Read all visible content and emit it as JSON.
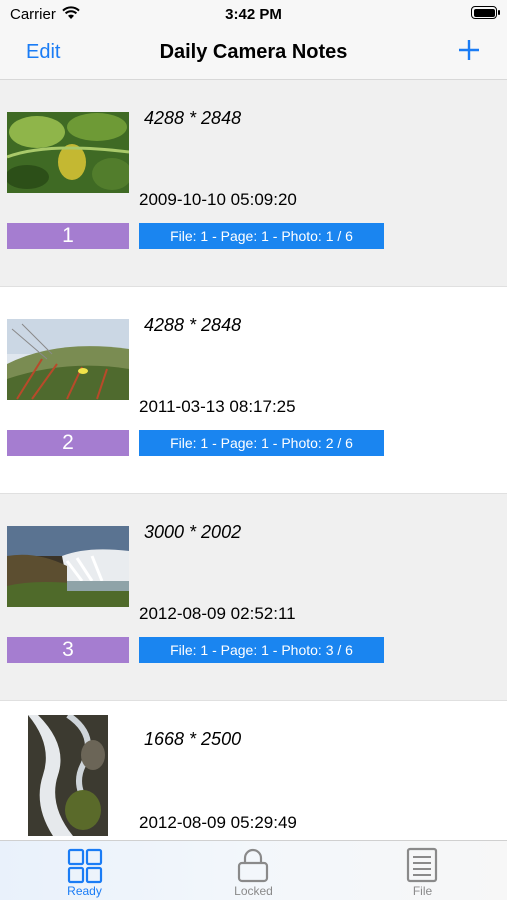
{
  "status_bar": {
    "carrier": "Carrier",
    "time": "3:42 PM"
  },
  "nav": {
    "edit_label": "Edit",
    "title": "Daily Camera Notes",
    "add_icon": "plus-icon"
  },
  "photos": [
    {
      "dimensions": "4288 * 2848",
      "date": "2009-10-10 05:09:20",
      "number": "1",
      "file_info": "File: 1 - Page: 1 - Photo: 1 / 6"
    },
    {
      "dimensions": "4288 * 2848",
      "date": "2011-03-13 08:17:25",
      "number": "2",
      "file_info": "File: 1 - Page: 1 - Photo: 2 / 6"
    },
    {
      "dimensions": "3000 * 2002",
      "date": "2012-08-09 02:52:11",
      "number": "3",
      "file_info": "File: 1 - Page: 1 - Photo: 3 / 6"
    },
    {
      "dimensions": "1668 * 2500",
      "date": "2012-08-09 05:29:49"
    }
  ],
  "tabs": [
    {
      "label": "Ready",
      "icon": "grid-icon",
      "active": true
    },
    {
      "label": "Locked",
      "icon": "lock-icon",
      "active": false
    },
    {
      "label": "File",
      "icon": "document-icon",
      "active": false
    }
  ],
  "colors": {
    "accent": "#1a7cf5",
    "number_badge": "#a57dd0",
    "file_badge": "#1a85f0",
    "row_gray": "#f0f0f0"
  }
}
